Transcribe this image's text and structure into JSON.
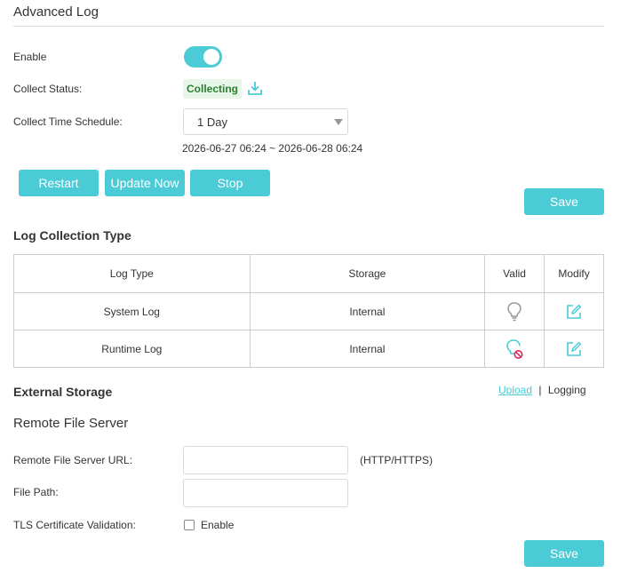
{
  "advanced_log": {
    "title": "Advanced Log",
    "enable_label": "Enable",
    "enable_state": true,
    "collect_status_label": "Collect Status:",
    "collect_status_value": "Collecting",
    "schedule_label": "Collect Time Schedule:",
    "schedule_value": "1 Day",
    "schedule_range": "2026-06-27 06:24 ~ 2026-06-28 06:24",
    "buttons": {
      "restart": "Restart",
      "update_now": "Update Now",
      "stop": "Stop",
      "save": "Save"
    }
  },
  "log_collection": {
    "heading": "Log Collection Type",
    "columns": [
      "Log Type",
      "Storage",
      "Valid",
      "Modify"
    ],
    "rows": [
      {
        "log_type": "System Log",
        "storage": "Internal",
        "valid_icon": "bulb-icon"
      },
      {
        "log_type": "Runtime Log",
        "storage": "Internal",
        "valid_icon": "bulb-disabled-icon"
      }
    ]
  },
  "external_storage": {
    "heading": "External Storage",
    "link_upload": "Upload",
    "separator": "|",
    "link_logging": "Logging"
  },
  "remote_server": {
    "title": "Remote File Server",
    "url_label": "Remote File Server URL:",
    "url_value": "",
    "url_hint": "(HTTP/HTTPS)",
    "path_label": "File Path:",
    "path_value": "",
    "tls_label": "TLS Certificate Validation:",
    "tls_checkbox_label": "Enable",
    "tls_checked": false,
    "save": "Save"
  },
  "colors": {
    "accent": "#4acbd6",
    "status_bg": "#e6f6e9",
    "status_text": "#2e7d32",
    "disabled_mark": "#e0245e"
  }
}
